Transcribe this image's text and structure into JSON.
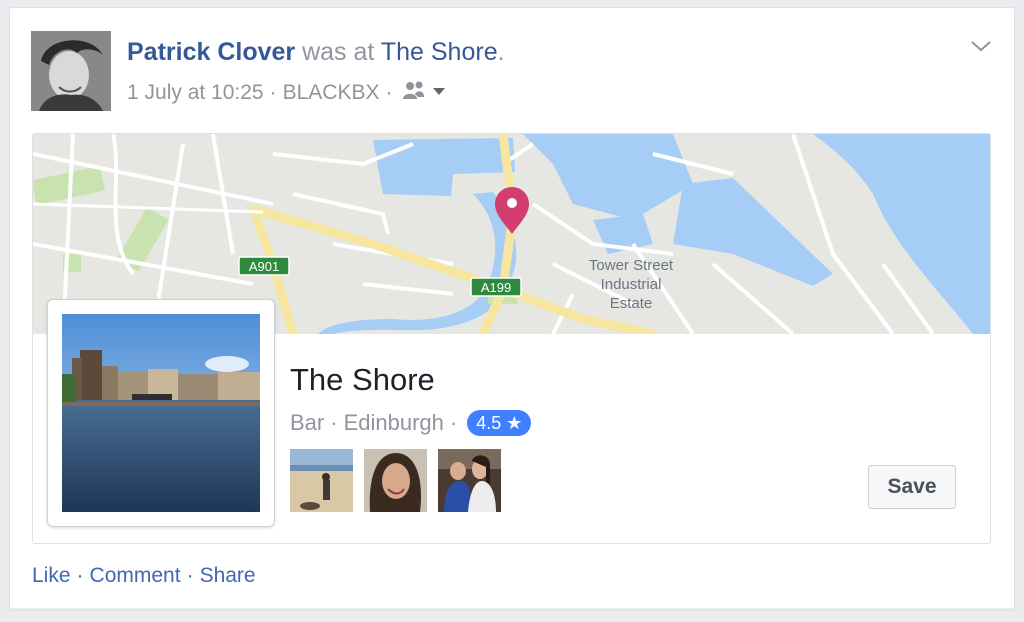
{
  "post": {
    "author": "Patrick Clover",
    "was_text": "was at",
    "place_link": "The Shore",
    "period": ".",
    "date": "1 July at 10:25",
    "app": "BLACKBX",
    "dot": "·",
    "audience_icon": "friends-icon",
    "menu_icon": "chevron-down-icon"
  },
  "map": {
    "labels": [
      "A901",
      "A199",
      "Tower Street",
      "Industrial",
      "Estate"
    ],
    "pin_color": "#d23f6f",
    "water_color": "#a5cdf6",
    "road_color": "#f7e6a0"
  },
  "place": {
    "name": "The Shore",
    "category": "Bar",
    "city": "Edinburgh",
    "rating": "4.5 ★",
    "save_label": "Save"
  },
  "actions": {
    "like": "Like",
    "comment": "Comment",
    "share": "Share",
    "sep": "·"
  },
  "colors": {
    "link": "#365899",
    "meta": "#90949c",
    "rating_bg": "#4080ff"
  }
}
